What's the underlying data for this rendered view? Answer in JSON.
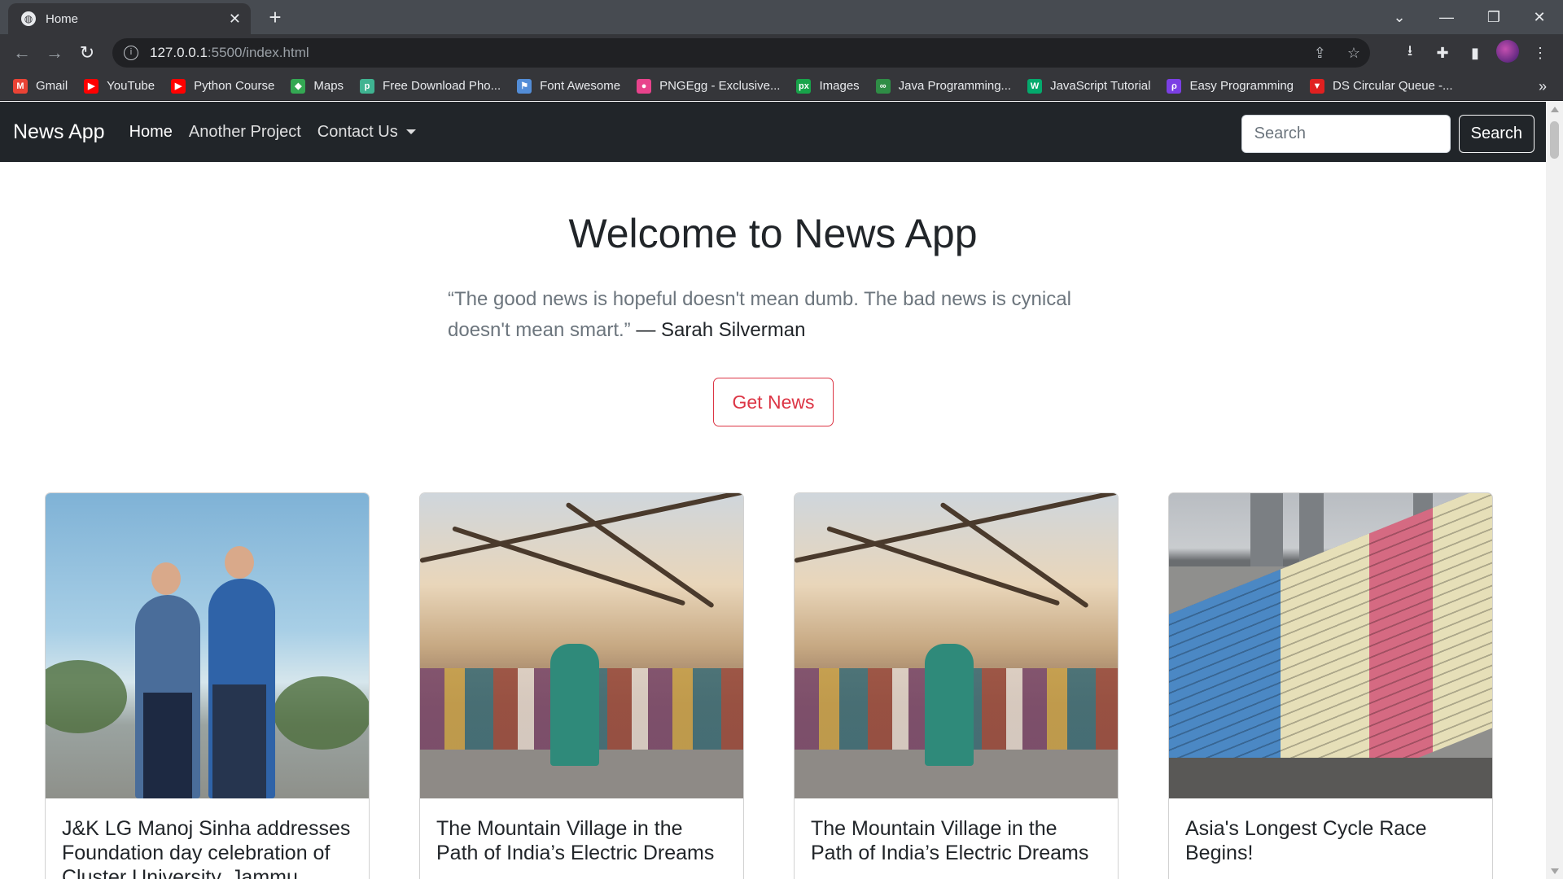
{
  "browser": {
    "tab_title": "Home",
    "tab_close": "✕",
    "new_tab": "+",
    "url_host": "127.0.0.1",
    "url_path": ":5500/index.html",
    "bookmarks": [
      {
        "label": "Gmail",
        "icon": "gmail-icon",
        "glyph": "M",
        "color": "#ea4335"
      },
      {
        "label": "YouTube",
        "icon": "youtube-icon",
        "glyph": "▶",
        "color": "#ff0000"
      },
      {
        "label": "Python Course",
        "icon": "youtube-icon",
        "glyph": "▶",
        "color": "#ff0000"
      },
      {
        "label": "Maps",
        "icon": "maps-icon",
        "glyph": "◆",
        "color": "#34a853"
      },
      {
        "label": "Free Download Pho...",
        "icon": "photo-icon",
        "glyph": "p",
        "color": "#3fb391"
      },
      {
        "label": "Font Awesome",
        "icon": "flag-icon",
        "glyph": "⚑",
        "color": "#538dd7"
      },
      {
        "label": "PNGEgg - Exclusive...",
        "icon": "egg-icon",
        "glyph": "●",
        "color": "#e8438c"
      },
      {
        "label": "Images",
        "icon": "px-icon",
        "glyph": "px",
        "color": "#18a34a"
      },
      {
        "label": "Java Programming...",
        "icon": "gfg-icon",
        "glyph": "∞",
        "color": "#2f8d46"
      },
      {
        "label": "JavaScript Tutorial",
        "icon": "w3-icon",
        "glyph": "W",
        "color": "#04aa6d"
      },
      {
        "label": "Easy Programming",
        "icon": "ep-icon",
        "glyph": "ρ",
        "color": "#7b3fe4"
      },
      {
        "label": "DS Circular Queue -...",
        "icon": "triangle-icon",
        "glyph": "▼",
        "color": "#e02020"
      }
    ]
  },
  "nav": {
    "brand": "News App",
    "links": [
      "Home",
      "Another Project",
      "Contact Us"
    ],
    "search_placeholder": "Search",
    "search_button": "Search"
  },
  "hero": {
    "title": "Welcome to News App",
    "quote": "“The good news is hopeful doesn't mean dumb. The bad news is cynical doesn't mean smart.”",
    "author": "— Sarah Silverman",
    "button": "Get News"
  },
  "cards": [
    {
      "title": "J&K LG Manoj Sinha addresses Foundation day celebration of Cluster University, Jammu"
    },
    {
      "title": "The Mountain Village in the Path of India’s Electric Dreams"
    },
    {
      "title": "The Mountain Village in the Path of India’s Electric Dreams"
    },
    {
      "title": "Asia's Longest Cycle Race Begins!"
    }
  ]
}
